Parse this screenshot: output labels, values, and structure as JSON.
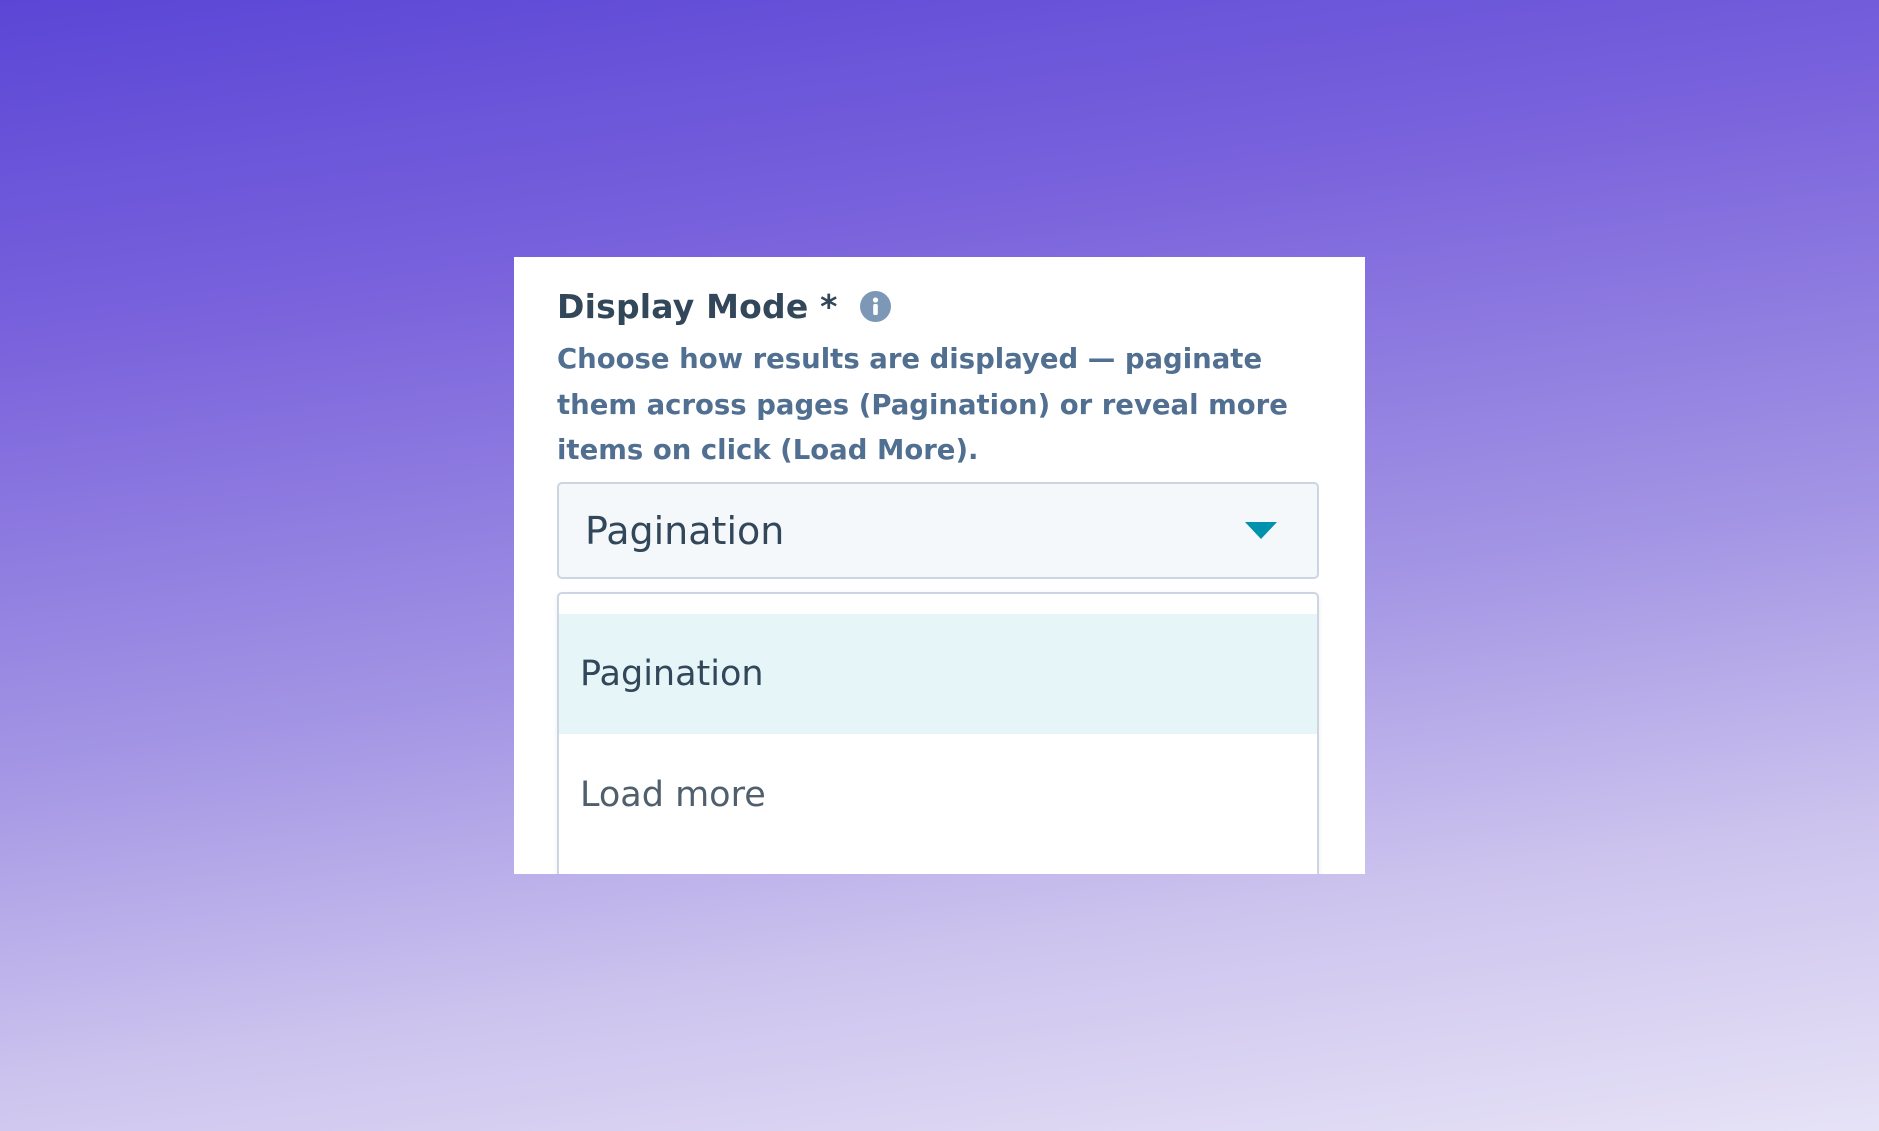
{
  "field": {
    "label": "Display Mode *",
    "info_icon": "info-icon",
    "help_text": "Choose how results are displayed — paginate them across pages (Pagination) or reveal more items on click (Load More).",
    "selected_value": "Pagination",
    "caret_icon": "caret-down-icon"
  },
  "dropdown": {
    "options": [
      {
        "label": "Pagination",
        "highlighted": true
      },
      {
        "label": "Load more",
        "highlighted": false
      }
    ]
  },
  "colors": {
    "label": "#33475b",
    "help_text": "#516f90",
    "info_icon": "#7c98b6",
    "caret": "#0091ae",
    "select_background": "#f5f8fa",
    "select_border": "#cbd6e2",
    "option_highlight": "#e5f5f8",
    "background_top": "#5b46d6",
    "background_bottom": "#e6e2f6"
  }
}
